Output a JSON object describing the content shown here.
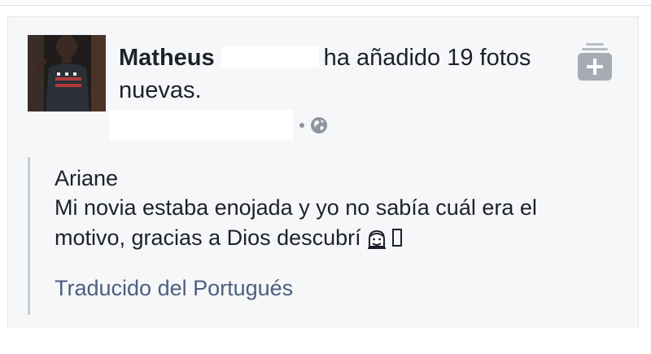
{
  "post": {
    "author_name": "Matheus",
    "action_text": "ha añadido 19 fotos nuevas.",
    "privacy_icon": "globe-icon",
    "add_icon": "add-photos-icon"
  },
  "quote": {
    "author": "Ariane",
    "text": "Mi novia estaba enojada y yo no sabía cuál era el motivo, gracias a Dios descubrí",
    "translated_label": "Traducido del Portugués"
  },
  "colors": {
    "text": "#1d2129",
    "link": "#4b5f80",
    "card_bg": "#f6f7f9",
    "quote_bar": "#c7ccd3",
    "icon_gray": "#9ea3ab"
  }
}
